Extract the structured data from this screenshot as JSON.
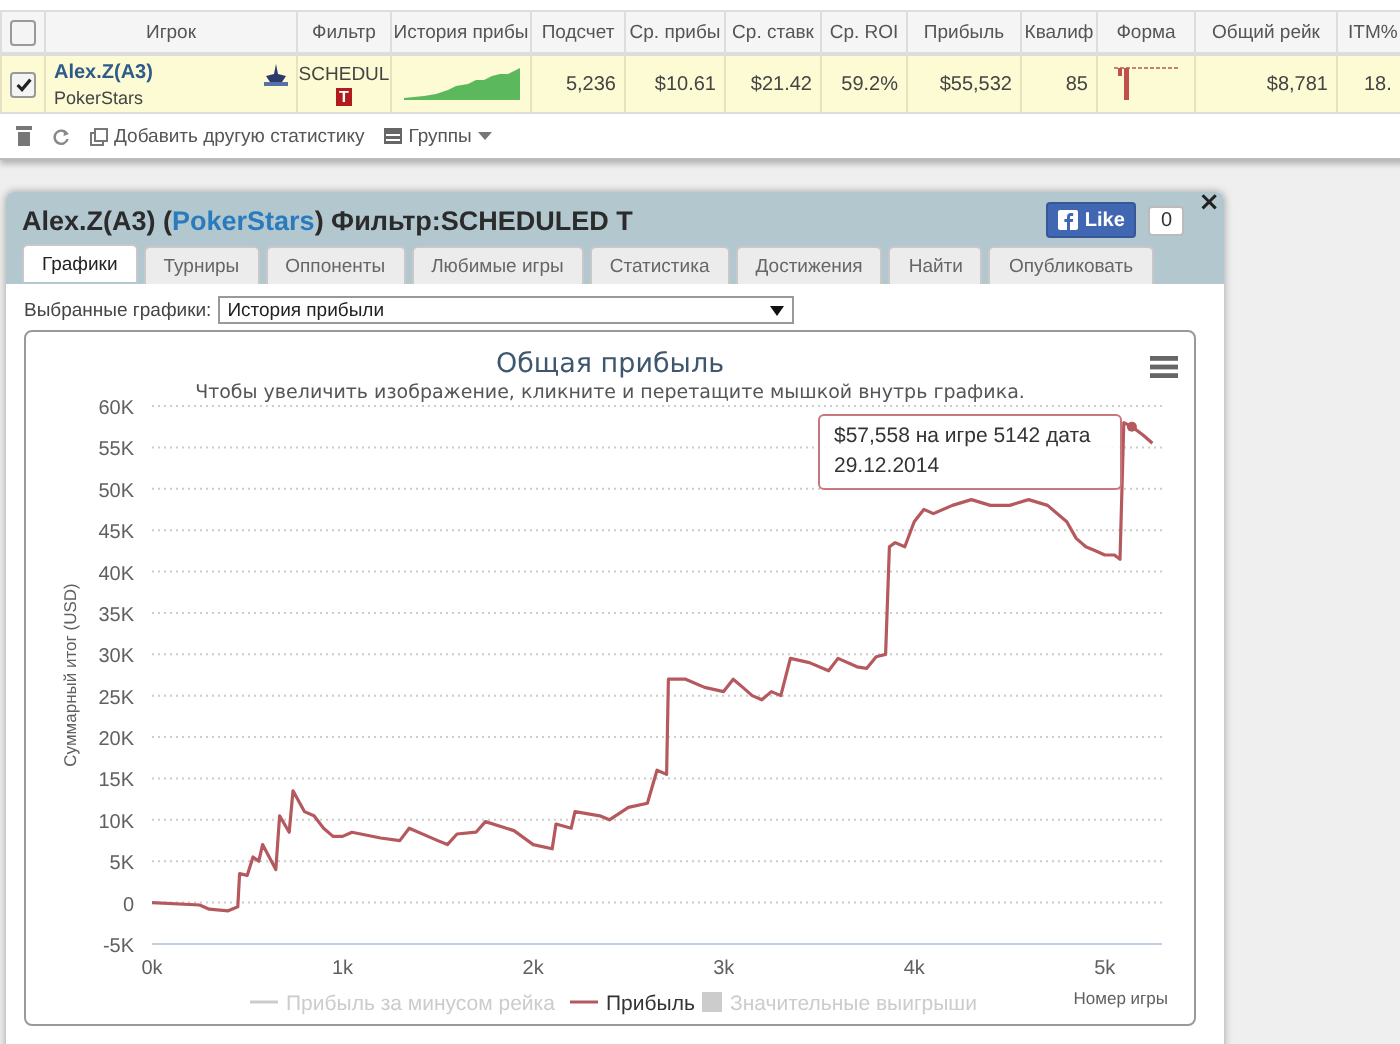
{
  "stats_table": {
    "header_checked": false,
    "columns": [
      "Игрок",
      "Фильтр",
      "История прибы",
      "Подсчет",
      "Ср. прибы",
      "Ср. ставк",
      "Ср. ROI",
      "Прибыль",
      "Квалиф",
      "Форма",
      "Общий рейк",
      "ITM%"
    ],
    "rows": [
      {
        "selected": true,
        "player": "Alex.Z(A3)",
        "site": "PokerStars",
        "filter": "SCHEDUL",
        "filter_badge": "T",
        "count": "5,236",
        "avg_profit": "$10.61",
        "avg_stake": "$21.42",
        "roi": "59.2%",
        "profit": "$55,532",
        "qualifier": "85",
        "rake": "$8,781",
        "itm": "18."
      }
    ],
    "toolbar": {
      "add_stat": "Добавить другую статистику",
      "groups": "Группы"
    }
  },
  "panel": {
    "title_before": "Alex.Z(A3) (",
    "site": "PokerStars",
    "title_after": ") Фильтр:SCHEDULED T",
    "like": "Like",
    "like_count": "0",
    "close": "×",
    "tabs": [
      {
        "label": "Графики",
        "selected": true
      },
      {
        "label": "Турниры",
        "selected": false
      },
      {
        "label": "Оппоненты",
        "selected": false
      },
      {
        "label": "Любимые игры",
        "selected": false
      },
      {
        "label": "Статистика",
        "selected": false
      },
      {
        "label": "Достижения",
        "selected": false
      },
      {
        "label": "Найти",
        "selected": false
      },
      {
        "label": "Опубликовать",
        "selected": false
      }
    ],
    "graph_select": {
      "label": "Выбранные графики:",
      "value": "История прибыли"
    },
    "chart": {
      "subtitle": "Чтобы увеличить изображение, кликните и перетащите мышкой внутрь графика.",
      "tooltip": "$57,558 на игре 5142 дата 29.12.2014",
      "legend": [
        {
          "label": "Прибыль за минусом рейка",
          "enabled": false,
          "kind": "line"
        },
        {
          "enabled": true,
          "kind": "series"
        },
        {
          "label": "Значительные выигрыши",
          "enabled": false,
          "kind": "area"
        }
      ],
      "chart_data": {
        "type": "line",
        "title": "Общая прибыль",
        "xlabel": "Номер игры",
        "ylabel": "Суммарный итог (USD)",
        "x": [
          0,
          250,
          300,
          400,
          450,
          460,
          500,
          530,
          560,
          580,
          650,
          670,
          720,
          740,
          800,
          850,
          900,
          950,
          1000,
          1050,
          1200,
          1300,
          1350,
          1500,
          1550,
          1600,
          1700,
          1750,
          1900,
          2000,
          2100,
          2120,
          2200,
          2220,
          2350,
          2400,
          2500,
          2600,
          2650,
          2700,
          2710,
          2800,
          2900,
          3000,
          3050,
          3100,
          3150,
          3200,
          3250,
          3300,
          3350,
          3450,
          3550,
          3600,
          3700,
          3750,
          3800,
          3850,
          3870,
          3900,
          3950,
          4000,
          4050,
          4100,
          4200,
          4300,
          4400,
          4500,
          4600,
          4700,
          4800,
          4850,
          4900,
          4950,
          5000,
          5050,
          5080,
          5100,
          5142,
          5200,
          5250
        ],
        "series": [
          {
            "name": "Прибыль",
            "color": "#b5595f",
            "values": [
              0,
              -300,
              -800,
              -1000,
              -500,
              3500,
              3300,
              5500,
              5000,
              7000,
              4000,
              10500,
              8500,
              13500,
              11000,
              10500,
              9000,
              8000,
              8000,
              8500,
              7800,
              7500,
              9000,
              7500,
              7000,
              8300,
              8500,
              9800,
              8700,
              7000,
              6500,
              9500,
              9000,
              11000,
              10500,
              10000,
              11500,
              12000,
              16000,
              15500,
              27000,
              27000,
              26000,
              25500,
              27000,
              26000,
              25000,
              24500,
              25500,
              25000,
              29500,
              29000,
              28000,
              29500,
              28500,
              28300,
              29700,
              30000,
              43000,
              43500,
              43000,
              46000,
              47500,
              47000,
              48000,
              48700,
              48000,
              48000,
              48700,
              48000,
              46000,
              44000,
              43000,
              42500,
              42000,
              42000,
              41500,
              58000,
              57500,
              56500,
              55500
            ]
          }
        ],
        "grid": true,
        "xlim": [
          0,
          5300
        ],
        "ylim": [
          -5000,
          60000
        ],
        "xticks": [
          {
            "value": 0,
            "label": "0k"
          },
          {
            "value": 1000,
            "label": "1k"
          },
          {
            "value": 2000,
            "label": "2k"
          },
          {
            "value": 3000,
            "label": "3k"
          },
          {
            "value": 4000,
            "label": "4k"
          },
          {
            "value": 5000,
            "label": "5k"
          }
        ],
        "yticks": [
          {
            "value": -5000,
            "label": "-5K"
          },
          {
            "value": 0,
            "label": "0"
          },
          {
            "value": 5000,
            "label": "5K"
          },
          {
            "value": 10000,
            "label": "10K"
          },
          {
            "value": 15000,
            "label": "15K"
          },
          {
            "value": 20000,
            "label": "20K"
          },
          {
            "value": 25000,
            "label": "25K"
          },
          {
            "value": 30000,
            "label": "30K"
          },
          {
            "value": 35000,
            "label": "35K"
          },
          {
            "value": 40000,
            "label": "40K"
          },
          {
            "value": 45000,
            "label": "45K"
          },
          {
            "value": 50000,
            "label": "50K"
          },
          {
            "value": 55000,
            "label": "55K"
          },
          {
            "value": 60000,
            "label": "60K"
          }
        ]
      }
    }
  }
}
